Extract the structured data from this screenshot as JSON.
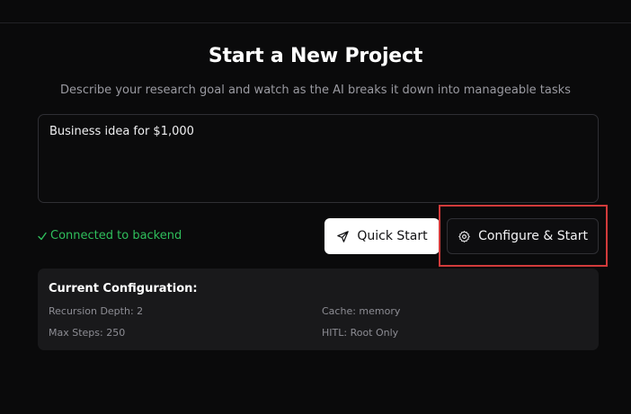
{
  "header": {
    "title": "Start a New Project",
    "subtitle": "Describe your research goal and watch as the AI breaks it down into manageable tasks"
  },
  "goal_input": {
    "value": "Business idea for $1,000"
  },
  "status": {
    "text": "Connected to backend",
    "color": "#2fbf5c"
  },
  "actions": {
    "quick_start_label": "Quick Start",
    "configure_start_label": "Configure & Start"
  },
  "configuration": {
    "title": "Current Configuration:",
    "recursion_depth": "Recursion Depth: 2",
    "max_steps": "Max Steps: 250",
    "cache": "Cache: memory",
    "hitl": "HITL: Root Only"
  },
  "icons": {
    "quick_start": "send-icon",
    "configure_start": "gear-icon",
    "status": "check-icon"
  },
  "colors": {
    "highlight": "#d23b3b",
    "background": "#0a0a0b"
  }
}
